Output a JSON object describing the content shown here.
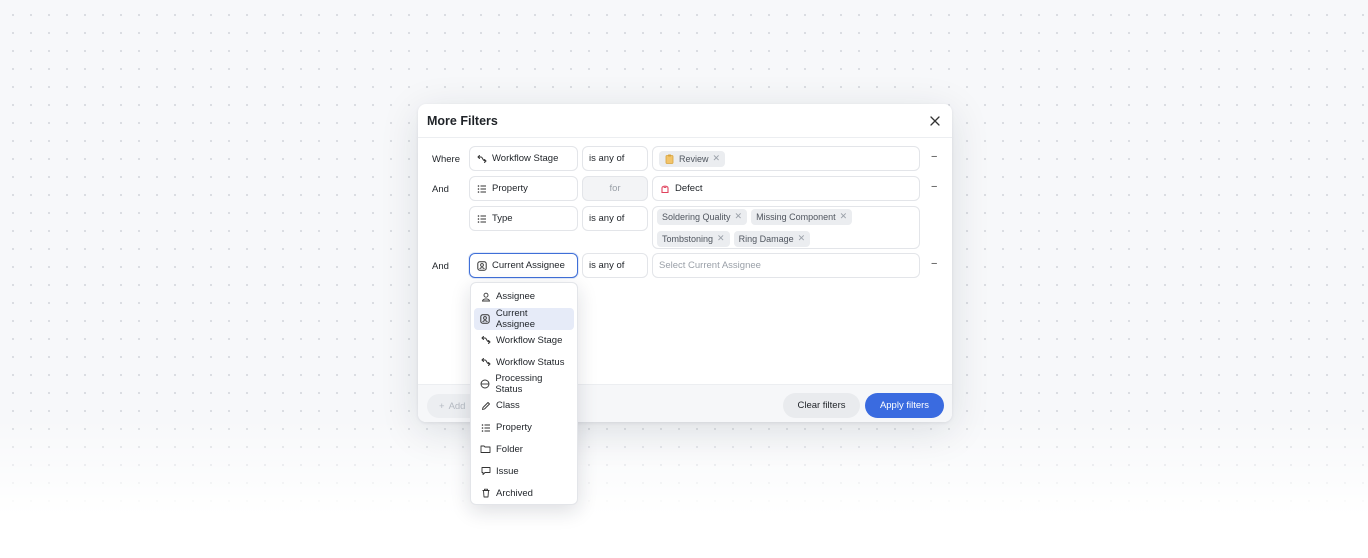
{
  "modal": {
    "title": "More Filters",
    "rows": [
      {
        "conj": "Where",
        "field": "Workflow Stage",
        "field_icon": "workflow-icon",
        "op": "is any of",
        "chips": [
          "Review"
        ],
        "chip_icon": "clipboard-icon"
      },
      {
        "conj": "And",
        "field": "Property",
        "field_icon": "list-icon",
        "op": "for",
        "value": "Defect",
        "value_icon": "defect-icon"
      },
      {
        "field": "Type",
        "field_icon": "list-icon",
        "op": "is any of",
        "chips": [
          "Soldering Quality",
          "Missing Component",
          "Tombstoning",
          "Ring Damage"
        ]
      },
      {
        "conj": "And",
        "field": "Current Assignee",
        "field_icon": "assignee-badge-icon",
        "op": "is any of",
        "placeholder": "Select Current Assignee"
      }
    ],
    "footer": {
      "add_label": "Add",
      "clear_label": "Clear filters",
      "apply_label": "Apply filters"
    }
  },
  "dropdown": {
    "items": [
      {
        "label": "Assignee",
        "icon": "user-icon"
      },
      {
        "label": "Current Assignee",
        "icon": "assignee-badge-icon",
        "active": true
      },
      {
        "label": "Workflow Stage",
        "icon": "workflow-icon"
      },
      {
        "label": "Workflow Status",
        "icon": "workflow-icon"
      },
      {
        "label": "Processing Status",
        "icon": "processing-icon"
      },
      {
        "label": "Class",
        "icon": "pencil-icon"
      },
      {
        "label": "Property",
        "icon": "list-icon"
      },
      {
        "label": "Folder",
        "icon": "folder-icon"
      },
      {
        "label": "Issue",
        "icon": "comment-icon"
      },
      {
        "label": "Archived",
        "icon": "trash-icon"
      }
    ]
  },
  "colors": {
    "accent": "#3a6be0",
    "review_chip_icon": "#d8a33c",
    "defect_icon": "#e0425c"
  }
}
